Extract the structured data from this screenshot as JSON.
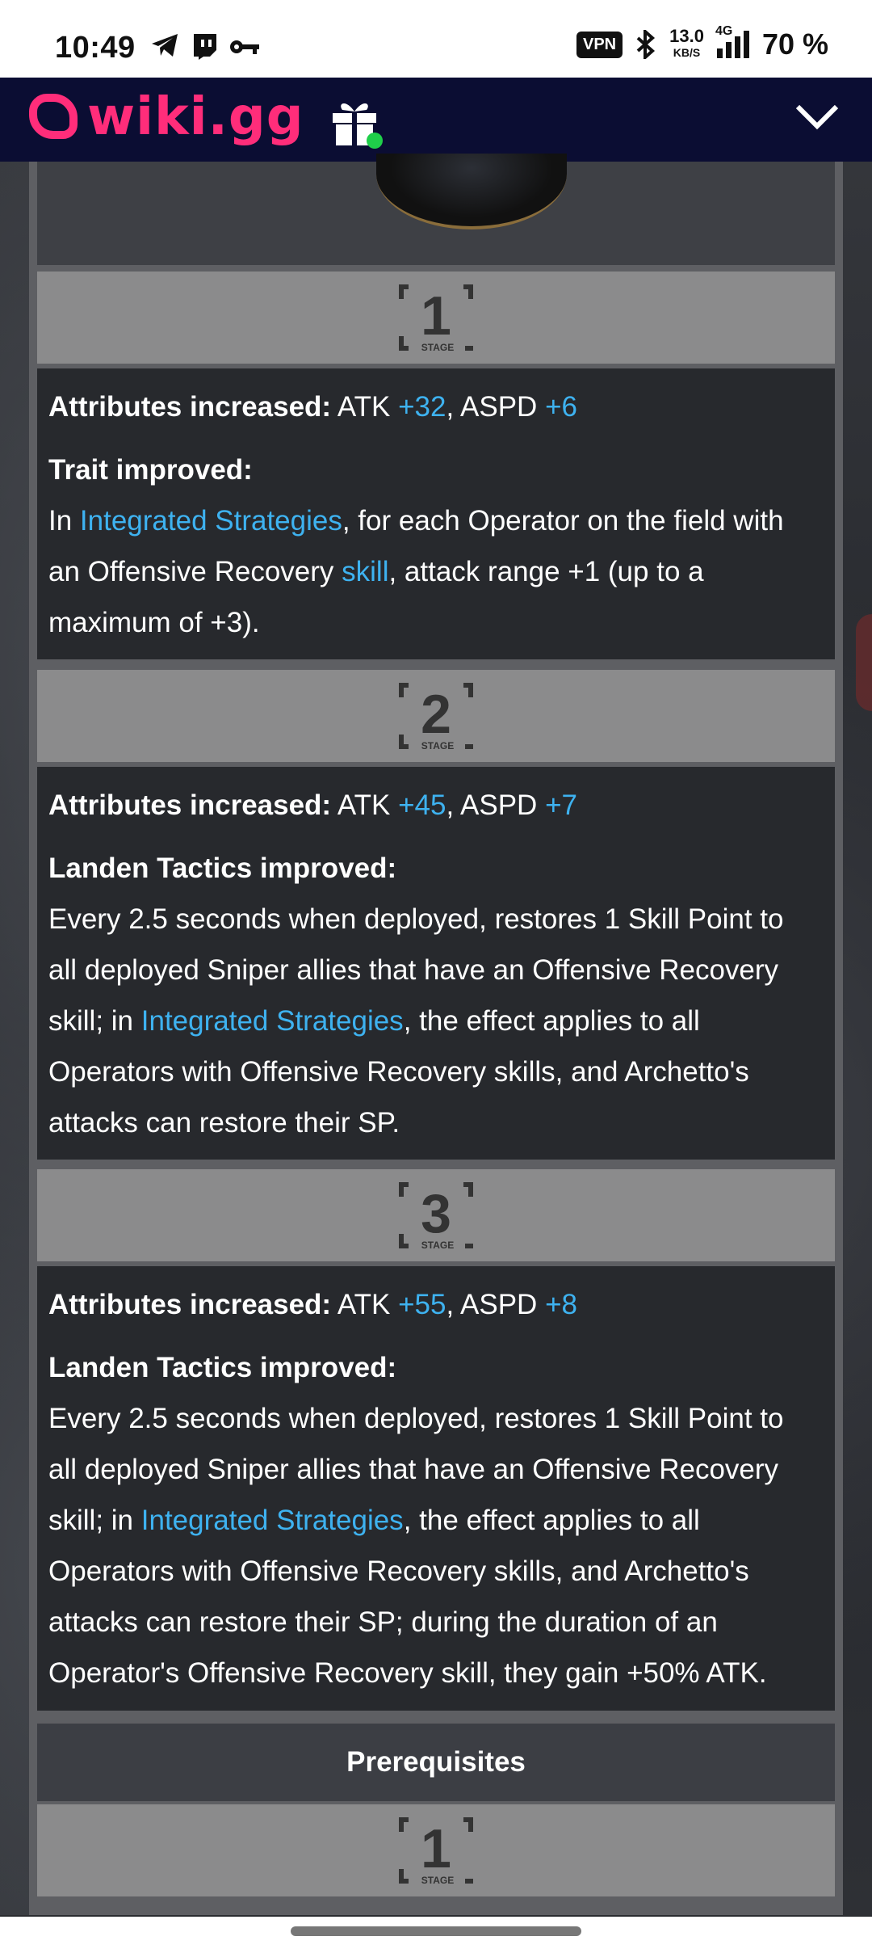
{
  "status_bar": {
    "time": "10:49",
    "vpn": "VPN",
    "speed_value": "13.0",
    "speed_unit": "KB/S",
    "network": "4G",
    "battery": "70 %"
  },
  "header": {
    "logo_text": "wiki.gg"
  },
  "stages": [
    {
      "label": "1",
      "stage_word": "STAGE",
      "attributes_label": "Attributes increased:",
      "atk_label": "ATK",
      "atk_value": "+32",
      "aspd_label": "ASPD",
      "aspd_value": "+6",
      "improved_label": "Trait improved:",
      "lines": [
        {
          "pre": "In ",
          "link": "Integrated Strategies",
          "post": ", for each Operator on the field with"
        },
        {
          "pre": "an Offensive Recovery ",
          "link": "skill",
          "post": ", attack range +1 (up to a"
        },
        {
          "pre": "maximum of +3).",
          "link": "",
          "post": ""
        }
      ]
    },
    {
      "label": "2",
      "stage_word": "STAGE",
      "attributes_label": "Attributes increased:",
      "atk_label": "ATK",
      "atk_value": "+45",
      "aspd_label": "ASPD",
      "aspd_value": "+7",
      "improved_label": "Landen Tactics improved:",
      "lines": [
        {
          "pre": "Every 2.5 seconds when deployed, restores 1 Skill Point to",
          "link": "",
          "post": ""
        },
        {
          "pre": "all deployed Sniper allies that have an Offensive Recovery",
          "link": "",
          "post": ""
        },
        {
          "pre": "skill; in ",
          "link": "Integrated Strategies",
          "post": ", the effect applies to all"
        },
        {
          "pre": "Operators with Offensive Recovery skills, and Archetto's",
          "link": "",
          "post": ""
        },
        {
          "pre": "attacks can restore their SP.",
          "link": "",
          "post": ""
        }
      ]
    },
    {
      "label": "3",
      "stage_word": "STAGE",
      "attributes_label": "Attributes increased:",
      "atk_label": "ATK",
      "atk_value": "+55",
      "aspd_label": "ASPD",
      "aspd_value": "+8",
      "improved_label": "Landen Tactics improved:",
      "lines": [
        {
          "pre": "Every 2.5 seconds when deployed, restores 1 Skill Point to",
          "link": "",
          "post": ""
        },
        {
          "pre": "all deployed Sniper allies that have an Offensive Recovery",
          "link": "",
          "post": ""
        },
        {
          "pre": "skill; in ",
          "link": "Integrated Strategies",
          "post": ", the effect applies to all"
        },
        {
          "pre": "Operators with Offensive Recovery skills, and Archetto's",
          "link": "",
          "post": ""
        },
        {
          "pre": "attacks can restore their SP; during the duration of an",
          "link": "",
          "post": ""
        },
        {
          "pre": "Operator's Offensive Recovery skill, they gain +50% ATK.",
          "link": "",
          "post": ""
        }
      ]
    }
  ],
  "prerequisites": {
    "title": "Prerequisites",
    "stage_label": "1",
    "stage_word": "STAGE"
  },
  "colors": {
    "link": "#3eb2f0",
    "brand": "#ff2d7a",
    "header_bg": "#0b0d33",
    "gift_dot": "#1fcf4a"
  }
}
